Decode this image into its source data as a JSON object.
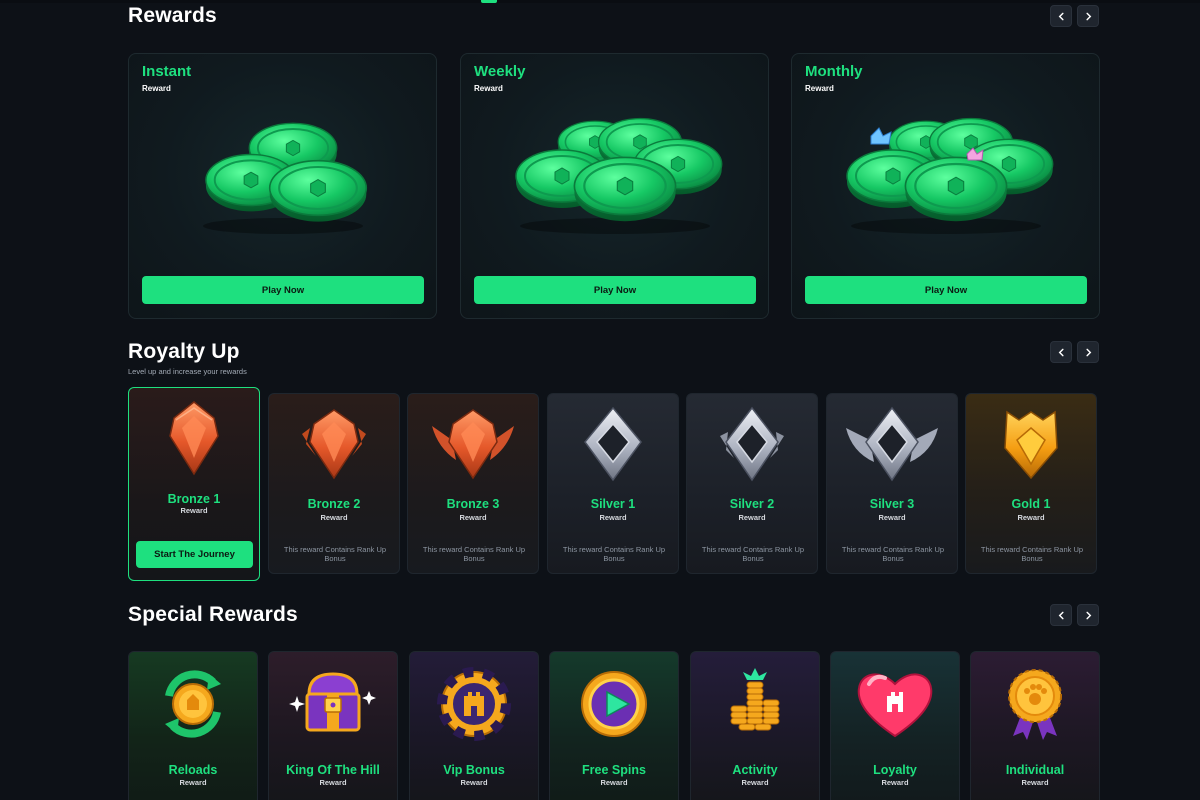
{
  "sections": {
    "rewards": {
      "title": "Rewards"
    },
    "royalty": {
      "title": "Royalty Up",
      "subtitle": "Level up and increase your rewards"
    },
    "special": {
      "title": "Special Rewards"
    }
  },
  "reward_cards": [
    {
      "title": "Instant",
      "subtitle": "Reward",
      "button": "Play Now",
      "icon": "coin-pile-icon"
    },
    {
      "title": "Weekly",
      "subtitle": "Reward",
      "button": "Play Now",
      "icon": "coin-pile-icon"
    },
    {
      "title": "Monthly",
      "subtitle": "Reward",
      "button": "Play Now",
      "icon": "coin-pile-icon"
    }
  ],
  "rank_cards": [
    {
      "title": "Bronze 1",
      "subtitle": "Reward",
      "button": "Start The Journey",
      "tier": "bronze",
      "icon": "bronze-rank-1-icon"
    },
    {
      "title": "Bronze 2",
      "subtitle": "Reward",
      "desc": "This reward Contains Rank Up Bonus",
      "tier": "bronze",
      "icon": "bronze-rank-2-icon"
    },
    {
      "title": "Bronze 3",
      "subtitle": "Reward",
      "desc": "This reward Contains Rank Up Bonus",
      "tier": "bronze",
      "icon": "bronze-rank-3-icon"
    },
    {
      "title": "Silver 1",
      "subtitle": "Reward",
      "desc": "This reward Contains Rank Up Bonus",
      "tier": "silver",
      "icon": "silver-rank-1-icon"
    },
    {
      "title": "Silver 2",
      "subtitle": "Reward",
      "desc": "This reward Contains Rank Up Bonus",
      "tier": "silver",
      "icon": "silver-rank-2-icon"
    },
    {
      "title": "Silver 3",
      "subtitle": "Reward",
      "desc": "This reward Contains Rank Up Bonus",
      "tier": "silver",
      "icon": "silver-rank-3-icon"
    },
    {
      "title": "Gold 1",
      "subtitle": "Reward",
      "desc": "This reward Contains Rank Up Bonus",
      "tier": "gold",
      "icon": "gold-rank-1-icon"
    }
  ],
  "special_cards": [
    {
      "title": "Reloads",
      "subtitle": "Reward",
      "icon": "reload-coin-icon"
    },
    {
      "title": "King Of The Hill",
      "subtitle": "Reward",
      "icon": "treasure-chest-icon"
    },
    {
      "title": "Vip Bonus",
      "subtitle": "Reward",
      "icon": "vip-chip-icon"
    },
    {
      "title": "Free Spins",
      "subtitle": "Reward",
      "icon": "play-coin-icon"
    },
    {
      "title": "Activity",
      "subtitle": "Reward",
      "icon": "coin-stacks-icon"
    },
    {
      "title": "Loyalty",
      "subtitle": "Reward",
      "icon": "heart-icon"
    },
    {
      "title": "Individual",
      "subtitle": "Reward",
      "icon": "medal-icon"
    }
  ],
  "colors": {
    "accent": "#1ee07f",
    "background": "#0d1117",
    "card_border_active": "#1ee07f",
    "bronze": "#e86a3c",
    "silver": "#b8bfcc",
    "gold": "#f5a81d"
  }
}
